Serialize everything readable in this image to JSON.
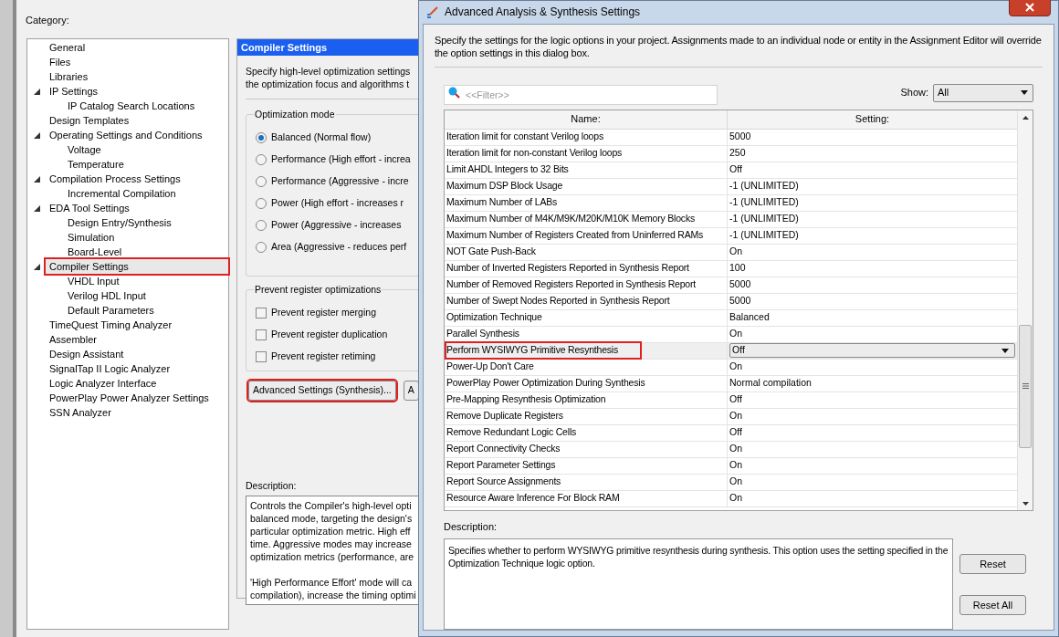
{
  "back_dialog": {
    "category_label": "Category:",
    "tree": [
      {
        "label": "General",
        "selected": false,
        "annotated": false
      },
      {
        "label": "Files",
        "selected": false,
        "annotated": false
      },
      {
        "label": "Libraries",
        "selected": false,
        "annotated": false
      },
      {
        "label": "IP Settings",
        "selected": false,
        "annotated": false,
        "expanded": true,
        "children": [
          {
            "label": "IP Catalog Search Locations",
            "selected": false,
            "annotated": false
          }
        ]
      },
      {
        "label": "Design Templates",
        "selected": false,
        "annotated": false
      },
      {
        "label": "Operating Settings and Conditions",
        "selected": false,
        "annotated": false,
        "expanded": true,
        "children": [
          {
            "label": "Voltage",
            "selected": false,
            "annotated": false
          },
          {
            "label": "Temperature",
            "selected": false,
            "annotated": false
          }
        ]
      },
      {
        "label": "Compilation Process Settings",
        "selected": false,
        "annotated": false,
        "expanded": true,
        "children": [
          {
            "label": "Incremental Compilation",
            "selected": false,
            "annotated": false
          }
        ]
      },
      {
        "label": "EDA Tool Settings",
        "selected": false,
        "annotated": false,
        "expanded": true,
        "children": [
          {
            "label": "Design Entry/Synthesis",
            "selected": false,
            "annotated": false
          },
          {
            "label": "Simulation",
            "selected": false,
            "annotated": false
          },
          {
            "label": "Board-Level",
            "selected": false,
            "annotated": false
          }
        ]
      },
      {
        "label": "Compiler Settings",
        "selected": true,
        "annotated": true,
        "expanded": true,
        "children": [
          {
            "label": "VHDL Input",
            "selected": false,
            "annotated": false
          },
          {
            "label": "Verilog HDL Input",
            "selected": false,
            "annotated": false
          },
          {
            "label": "Default Parameters",
            "selected": false,
            "annotated": false
          }
        ]
      },
      {
        "label": "TimeQuest Timing Analyzer",
        "selected": false,
        "annotated": false
      },
      {
        "label": "Assembler",
        "selected": false,
        "annotated": false
      },
      {
        "label": "Design Assistant",
        "selected": false,
        "annotated": false
      },
      {
        "label": "SignalTap II Logic Analyzer",
        "selected": false,
        "annotated": false
      },
      {
        "label": "Logic Analyzer Interface",
        "selected": false,
        "annotated": false
      },
      {
        "label": "PowerPlay Power Analyzer Settings",
        "selected": false,
        "annotated": false
      },
      {
        "label": "SSN Analyzer",
        "selected": false,
        "annotated": false
      }
    ],
    "panel": {
      "title": "Compiler Settings",
      "intro_lines": [
        "Specify high-level optimization settings",
        "the optimization focus and algorithms t"
      ],
      "optimization_mode": {
        "title": "Optimization mode",
        "options": [
          {
            "label": "Balanced (Normal flow)",
            "selected": true
          },
          {
            "label": "Performance (High effort - increa",
            "selected": false
          },
          {
            "label": "Performance (Aggressive - incre",
            "selected": false
          },
          {
            "label": "Power (High effort - increases r",
            "selected": false
          },
          {
            "label": "Power (Aggressive - increases",
            "selected": false
          },
          {
            "label": "Area (Aggressive - reduces perf",
            "selected": false
          }
        ]
      },
      "prevent": {
        "title": "Prevent register optimizations",
        "options": [
          {
            "label": "Prevent register merging",
            "checked": false
          },
          {
            "label": "Prevent register duplication",
            "checked": false
          },
          {
            "label": "Prevent register retiming",
            "checked": false
          }
        ]
      },
      "buttons": [
        {
          "label": "Advanced Settings (Synthesis)...",
          "annotated": true
        },
        {
          "label": "A",
          "annotated": false
        }
      ],
      "description_label": "Description:",
      "description_paragraphs": [
        [
          "Controls the Compiler's high-level opti",
          "balanced mode, targeting the design's",
          "particular optimization metric.  High eff",
          "time.  Aggressive modes may increase",
          "optimization metrics (performance, are"
        ],
        [
          "'High Performance Effort' mode will ca",
          "compilation), increase the timing optimi"
        ]
      ]
    }
  },
  "dialog": {
    "title": "Advanced Analysis & Synthesis Settings",
    "intro": "Specify the settings for the logic options in your project.  Assignments made to an individual node or entity in the Assignment Editor will override the option settings in this dialog box.",
    "filter": {
      "placeholder": "<<Filter>>"
    },
    "show": {
      "label": "Show:",
      "value": "All"
    },
    "table": {
      "columns": [
        "Name:",
        "Setting:"
      ],
      "rows": [
        {
          "name": "Iteration limit for constant Verilog loops",
          "setting": "5000",
          "selected": false,
          "annotated": false
        },
        {
          "name": "Iteration limit for non-constant Verilog loops",
          "setting": "250",
          "selected": false,
          "annotated": false
        },
        {
          "name": "Limit AHDL Integers to 32 Bits",
          "setting": "Off",
          "selected": false,
          "annotated": false
        },
        {
          "name": "Maximum DSP Block Usage",
          "setting": "-1 (UNLIMITED)",
          "selected": false,
          "annotated": false
        },
        {
          "name": "Maximum Number of LABs",
          "setting": "-1 (UNLIMITED)",
          "selected": false,
          "annotated": false
        },
        {
          "name": "Maximum Number of M4K/M9K/M20K/M10K Memory Blocks",
          "setting": "-1 (UNLIMITED)",
          "selected": false,
          "annotated": false
        },
        {
          "name": "Maximum Number of Registers Created from Uninferred RAMs",
          "setting": "-1 (UNLIMITED)",
          "selected": false,
          "annotated": false
        },
        {
          "name": "NOT Gate Push-Back",
          "setting": "On",
          "selected": false,
          "annotated": false
        },
        {
          "name": "Number of Inverted Registers Reported in Synthesis Report",
          "setting": "100",
          "selected": false,
          "annotated": false
        },
        {
          "name": "Number of Removed Registers Reported in Synthesis Report",
          "setting": "5000",
          "selected": false,
          "annotated": false
        },
        {
          "name": "Number of Swept Nodes Reported in Synthesis Report",
          "setting": "5000",
          "selected": false,
          "annotated": false
        },
        {
          "name": "Optimization Technique",
          "setting": "Balanced",
          "selected": false,
          "annotated": false
        },
        {
          "name": "Parallel Synthesis",
          "setting": "On",
          "selected": false,
          "annotated": false
        },
        {
          "name": "Perform WYSIWYG Primitive Resynthesis",
          "setting": "Off",
          "selected": true,
          "annotated": true
        },
        {
          "name": "Power-Up Don't Care",
          "setting": "On",
          "selected": false,
          "annotated": false
        },
        {
          "name": "PowerPlay Power Optimization During Synthesis",
          "setting": "Normal compilation",
          "selected": false,
          "annotated": false
        },
        {
          "name": "Pre-Mapping Resynthesis Optimization",
          "setting": "Off",
          "selected": false,
          "annotated": false
        },
        {
          "name": "Remove Duplicate Registers",
          "setting": "On",
          "selected": false,
          "annotated": false
        },
        {
          "name": "Remove Redundant Logic Cells",
          "setting": "Off",
          "selected": false,
          "annotated": false
        },
        {
          "name": "Report Connectivity Checks",
          "setting": "On",
          "selected": false,
          "annotated": false
        },
        {
          "name": "Report Parameter Settings",
          "setting": "On",
          "selected": false,
          "annotated": false
        },
        {
          "name": "Report Source Assignments",
          "setting": "On",
          "selected": false,
          "annotated": false
        },
        {
          "name": "Resource Aware Inference For Block RAM",
          "setting": "On",
          "selected": false,
          "annotated": false
        }
      ]
    },
    "description_label": "Description:",
    "description": "Specifies whether to perform WYSIWYG primitive resynthesis during synthesis. This option uses the setting specified in the Optimization Technique logic option.",
    "buttons": [
      "Reset",
      "Reset All"
    ]
  }
}
